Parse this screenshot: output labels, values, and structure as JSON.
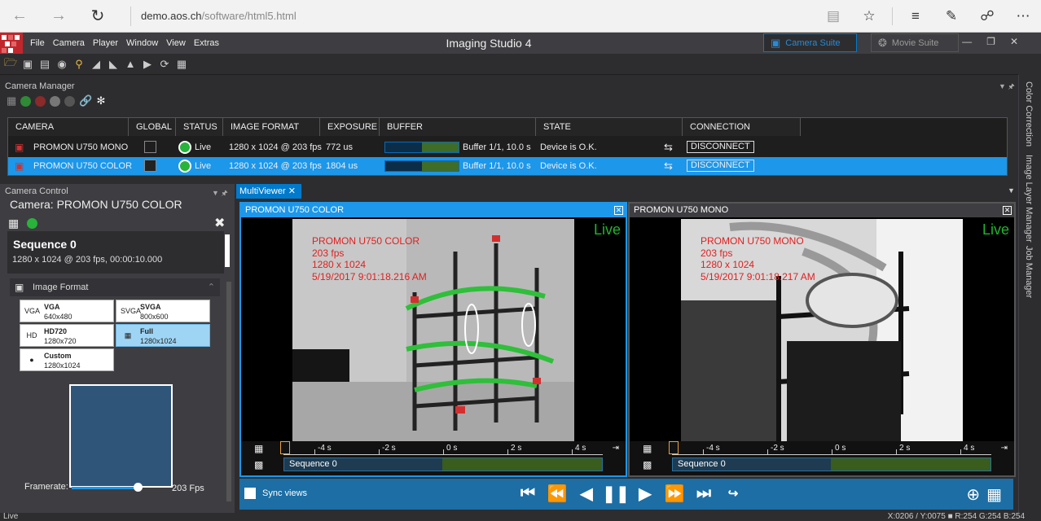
{
  "browser": {
    "url_host": "demo.aos.ch",
    "url_path": "/software/html5.html"
  },
  "app": {
    "title": "Imaging Studio 4",
    "menu": [
      "File",
      "Camera",
      "Player",
      "Window",
      "View",
      "Extras"
    ],
    "camera_suite": "Camera Suite",
    "movie_suite": "Movie Suite"
  },
  "camera_manager": {
    "title": "Camera Manager",
    "columns": [
      "CAMERA",
      "GLOBAL",
      "STATUS",
      "IMAGE FORMAT",
      "EXPOSURE",
      "BUFFER",
      "STATE",
      "CONNECTION"
    ],
    "rows": [
      {
        "camera": "PROMON U750 MONO",
        "status": "Live",
        "format": "1280 x 1024 @ 203 fps",
        "exposure": "772 us",
        "buffer": "Buffer 1/1, 10.0 s",
        "state": "Device is O.K.",
        "connection": "DISCONNECT",
        "buffer_fill": 0.5
      },
      {
        "camera": "PROMON U750 COLOR",
        "status": "Live",
        "format": "1280 x 1024 @ 203 fps",
        "exposure": "1804 us",
        "buffer": "Buffer 1/1, 10.0 s",
        "state": "Device is O.K.",
        "connection": "DISCONNECT",
        "buffer_fill": 0.5
      }
    ]
  },
  "camera_control": {
    "title": "Camera Control",
    "camera_label": "Camera:",
    "camera_name": "PROMON U750 COLOR",
    "sequence_title": "Sequence 0",
    "sequence_info": "1280 x 1024 @ 203 fps, 00:00:10.000",
    "image_format_title": "Image Format",
    "formats": [
      {
        "name": "VGA",
        "res": "640x480",
        "icon": "VGA"
      },
      {
        "name": "SVGA",
        "res": "800x600",
        "icon": "SVGA"
      },
      {
        "name": "HD720",
        "res": "1280x720",
        "icon": "HD"
      },
      {
        "name": "Full",
        "res": "1280x1024",
        "icon": "chip"
      },
      {
        "name": "Custom",
        "res": "1280x1024",
        "icon": "person"
      }
    ],
    "framerate_label": "Framerate:",
    "framerate_value": "203 Fps",
    "framerate_fraction": 0.95
  },
  "multiviewer": {
    "tab": "MultiViewer",
    "views": [
      {
        "title": "PROMON U750 COLOR",
        "live": "Live",
        "overlay": [
          "PROMON U750 COLOR",
          "203 fps",
          "1280 x 1024",
          "5/19/2017 9:01:18.216 AM"
        ],
        "sequence": "Sequence 0"
      },
      {
        "title": "PROMON U750 MONO",
        "live": "Live",
        "overlay": [
          "PROMON U750 MONO",
          "203 fps",
          "1280 x 1024",
          "5/19/2017 9:01:18.217 AM"
        ],
        "sequence": "Sequence 0"
      }
    ],
    "ticks": [
      "-4 s",
      "-2 s",
      "0 s",
      "2 s",
      "4 s"
    ],
    "sync_label": "Sync views"
  },
  "right_tabs": [
    "Color Correction",
    "Image Layer Manager",
    "Job Manager"
  ],
  "status": {
    "left": "Live",
    "right": "X:0206 / Y:0075 ■ R:254 G:254 B:254"
  },
  "colors": {
    "accent": "#1c97ea",
    "live_green": "#1fb52c",
    "overlay_red": "#e02020"
  }
}
